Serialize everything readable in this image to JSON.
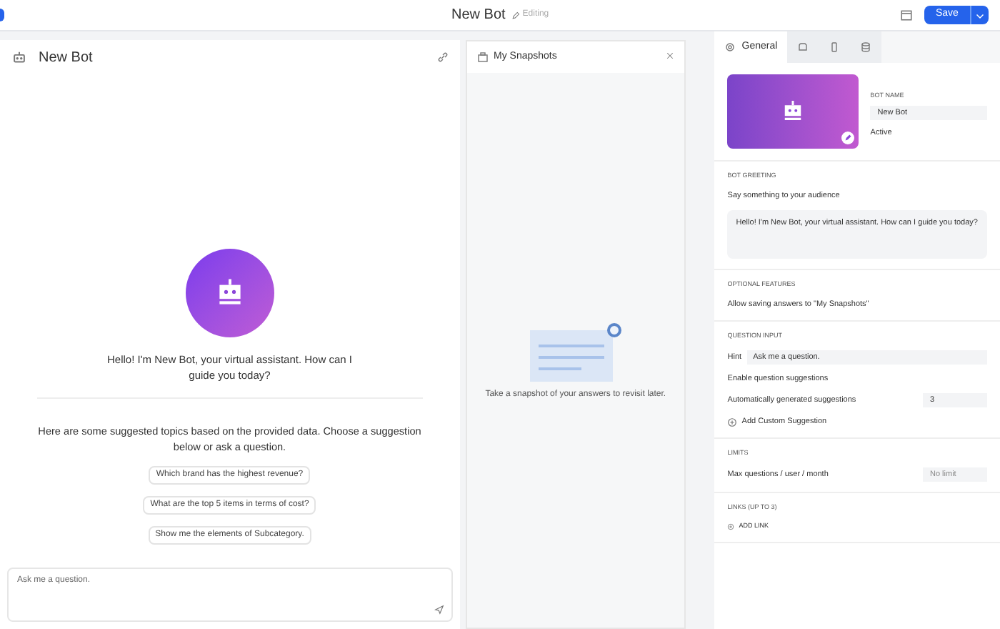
{
  "top_bar": {
    "title": "New Bot",
    "edit_label": "Editing",
    "save_button": "Save"
  },
  "chat_panel": {
    "title": "New Bot",
    "greeting": "Hello! I'm New Bot, your virtual assistant. How can I guide you today?",
    "intro": "Here are some suggested topics based on the provided data. Choose a suggestion below or ask a question.",
    "suggestions": [
      "Which brand has the highest revenue?",
      "What are the top 5 items in terms of cost?",
      "Show me the elements of Subcategory."
    ],
    "input": {
      "placeholder": "Ask me a question."
    }
  },
  "snapshots_panel": {
    "title": "My Snapshots",
    "empty_text": "Take a snapshot of your answers to revisit later."
  },
  "settings": {
    "tabs": [
      {
        "kind": "general",
        "label": "General",
        "selected": true
      },
      {
        "kind": "theme",
        "selected": false
      },
      {
        "kind": "device",
        "selected": false
      },
      {
        "kind": "data",
        "selected": false
      }
    ],
    "bot_name_label": "BOT NAME",
    "bot_name": "New Bot",
    "active_label": "Active",
    "sections": [
      {
        "title": "BOT GREETING",
        "rows": [
          {
            "kind": "text",
            "label": "Say something to your audience"
          },
          {
            "kind": "textarea",
            "value": "Hello! I'm New Bot, your virtual assistant. How can I guide you today?"
          }
        ]
      },
      {
        "title": "OPTIONAL FEATURES",
        "rows": [
          {
            "kind": "text",
            "label": "Allow saving answers to \"My Snapshots\""
          }
        ]
      },
      {
        "title": "QUESTION INPUT",
        "rows": [
          {
            "kind": "hint",
            "label": "Hint",
            "value": "Ask me a question."
          },
          {
            "kind": "text",
            "label": "Enable question suggestions"
          },
          {
            "kind": "number",
            "label": "Automatically generated suggestions",
            "value": "3"
          },
          {
            "kind": "add",
            "label": "Add Custom Suggestion"
          }
        ]
      },
      {
        "title": "LIMITS",
        "rows": [
          {
            "kind": "select",
            "label": "Max questions / user / month",
            "value": "No limit"
          }
        ]
      },
      {
        "title": "LINKS (UP TO 3)",
        "rows": [
          {
            "kind": "add_link",
            "label": "ADD LINK"
          }
        ]
      }
    ]
  }
}
